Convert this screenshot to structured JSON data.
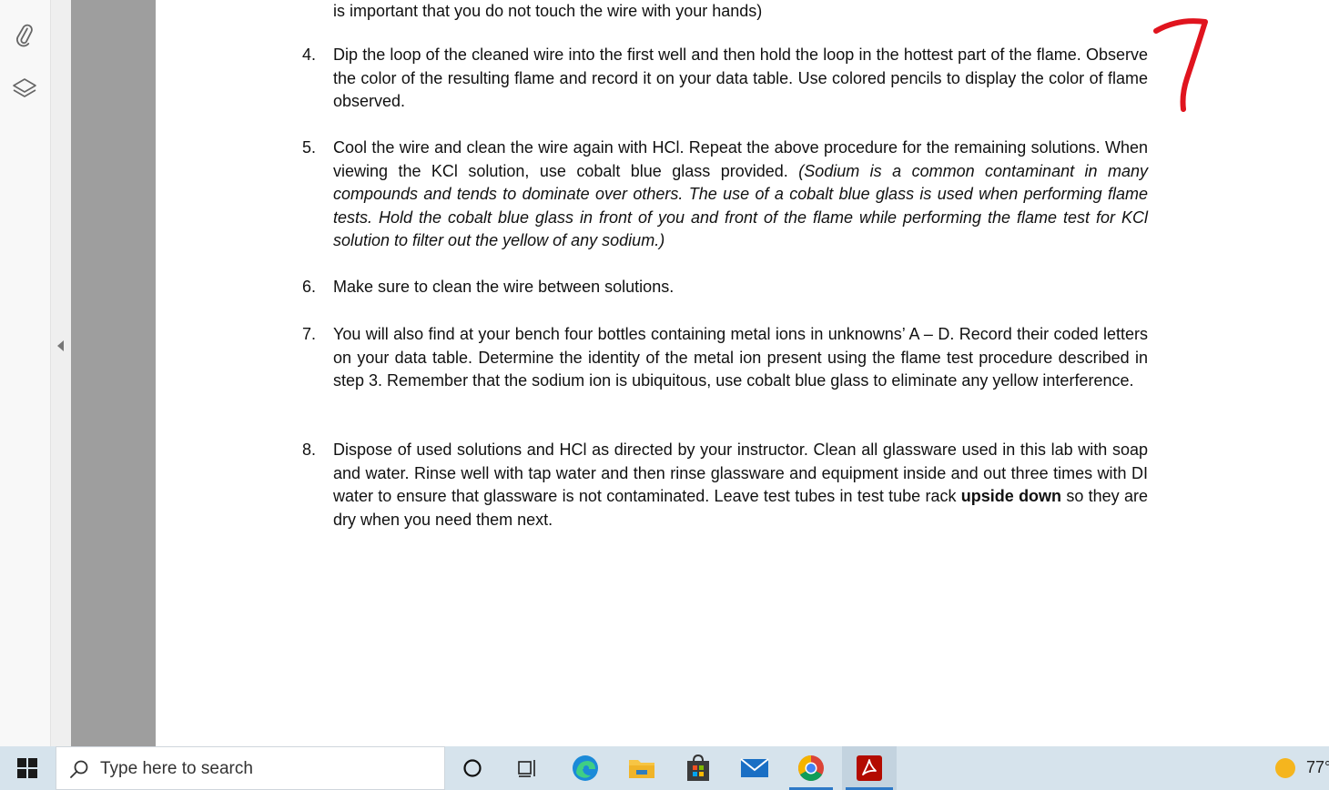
{
  "sidebar": {
    "tools": [
      {
        "icon": "paperclip-icon"
      },
      {
        "icon": "layers-icon"
      }
    ],
    "collapse_icon": "collapse-left-icon"
  },
  "document": {
    "top_fragment": "is important that you do not touch the wire with your hands)",
    "handwritten_page_number": "7",
    "steps": [
      {
        "num": "4.",
        "parts": [
          {
            "text": "Dip the loop of the cleaned wire into the first well and then hold the loop in the hottest part of the flame. Observe the color of the resulting flame and record it on your data table.  Use colored pencils to display the color of flame observed.",
            "style": "normal"
          }
        ]
      },
      {
        "num": "5.",
        "parts": [
          {
            "text": "Cool the wire and clean the wire again with HCl.  Repeat the above procedure for the remaining solutions. When viewing the KCl solution, use cobalt blue glass provided.  ",
            "style": "normal"
          },
          {
            "text": "(Sodium is a common contaminant in many compounds and tends to dominate over others.  The use of a cobalt blue glass is used when performing flame tests.  Hold the cobalt blue glass in front of you and front of the flame while performing the flame test for KCl solution to filter out the yellow of any sodium.)",
            "style": "italic"
          }
        ]
      },
      {
        "num": "6.",
        "parts": [
          {
            "text": "Make sure to clean the wire between solutions.",
            "style": "normal"
          }
        ]
      },
      {
        "num": "7.",
        "parts": [
          {
            "text": "You will also find at your bench four bottles containing metal ions in unknowns’ A – D.  Record their coded letters on your data table.  Determine the identity of the metal ion present using the flame test procedure described in step 3.  Remember that the sodium ion is ubiquitous, use cobalt blue glass to eliminate any yellow interference.",
            "style": "normal"
          }
        ]
      },
      {
        "num": "8.",
        "parts": [
          {
            "text": "Dispose of used solutions and HCl as directed by your instructor.  Clean all glassware used in this lab with soap and water.  Rinse well with tap water and then rinse glassware and equipment inside and out three times with DI water to ensure that glassware is not contaminated.  Leave test tubes in test tube rack ",
            "style": "normal"
          },
          {
            "text": "upside down",
            "style": "bold"
          },
          {
            "text": " so they are dry when you need them next.",
            "style": "normal"
          }
        ]
      }
    ]
  },
  "taskbar": {
    "start_icon": "windows-logo-icon",
    "search_placeholder": "Type here to search",
    "apps": [
      {
        "name": "cortana",
        "icon": "cortana-circle-icon"
      },
      {
        "name": "task-view",
        "icon": "task-view-icon"
      },
      {
        "name": "edge",
        "icon": "edge-icon"
      },
      {
        "name": "file-explorer",
        "icon": "folder-icon"
      },
      {
        "name": "store",
        "icon": "store-bag-icon"
      },
      {
        "name": "mail",
        "icon": "mail-icon"
      },
      {
        "name": "chrome",
        "icon": "chrome-icon"
      },
      {
        "name": "acrobat",
        "icon": "acrobat-icon"
      }
    ],
    "weather_icon": "sun-icon",
    "temperature": "77°"
  },
  "colors": {
    "handwriting": "#e0141e",
    "taskbar_bg": "#d6e3ec",
    "gutter": "#9e9e9e",
    "accent": "#2e79c7"
  }
}
